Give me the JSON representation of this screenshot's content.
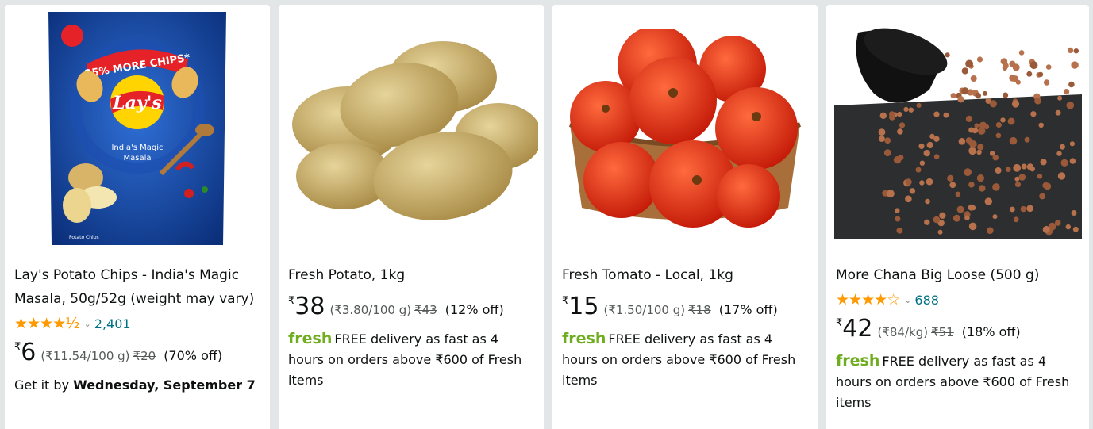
{
  "products": [
    {
      "image_alt": "Lay's India's Magic Masala packet",
      "title": "Lay's Potato Chips - India's Magic Masala, 50g/52g (weight may vary)",
      "stars": "★★★★½",
      "rating_count": "2,401",
      "currency": "₹",
      "price": "6",
      "unit_price": "(₹11.54/100 g)",
      "mrp": "₹20",
      "discount": "(70% off)",
      "delivery_prefix": "Get it by",
      "delivery_date": "Wednesday, September 7",
      "pack_texts": {
        "banner": "25% MORE CHIPS*",
        "brand": "Lay's",
        "flavor_line1": "India's Magic",
        "flavor_line2": "Masala",
        "type": "Potato Chips"
      }
    },
    {
      "image_alt": "Fresh potatoes",
      "title": "Fresh Potato, 1kg",
      "currency": "₹",
      "price": "38",
      "unit_price": "(₹3.80/100 g)",
      "mrp": "₹43",
      "discount": "(12% off)",
      "fresh_label": "fresh",
      "delivery_text": "FREE delivery as fast as 4 hours on orders above ₹600 of Fresh items"
    },
    {
      "image_alt": "Fresh tomatoes in a basket",
      "title": "Fresh Tomato - Local, 1kg",
      "currency": "₹",
      "price": "15",
      "unit_price": "(₹1.50/100 g)",
      "mrp": "₹18",
      "discount": "(17% off)",
      "fresh_label": "fresh",
      "delivery_text": "FREE delivery as fast as 4 hours on orders above ₹600 of Fresh items"
    },
    {
      "image_alt": "Chana spilling from a black bowl",
      "title": "More Chana Big Loose (500 g)",
      "stars": "★★★★☆",
      "rating_count": "688",
      "currency": "₹",
      "price": "42",
      "unit_price": "(₹84/kg)",
      "mrp": "₹51",
      "discount": "(18% off)",
      "fresh_label": "fresh",
      "delivery_text": "FREE delivery as fast as 4 hours on orders above ₹600 of Fresh items"
    }
  ],
  "colors": {
    "background": "#e3e6e6",
    "star": "#ff9900",
    "link": "#007185",
    "fresh": "#6ead1e"
  }
}
